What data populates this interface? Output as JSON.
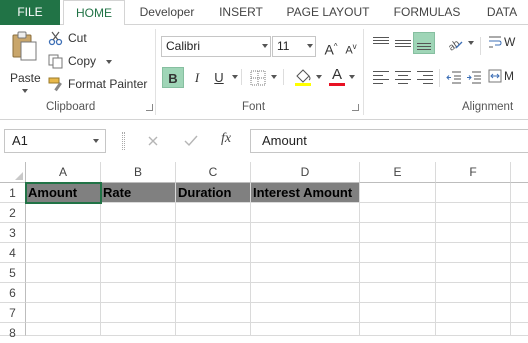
{
  "tabs": [
    "FILE",
    "HOME",
    "Developer",
    "INSERT",
    "PAGE LAYOUT",
    "FORMULAS",
    "DATA"
  ],
  "clipboard": {
    "paste": "Paste",
    "cut": "Cut",
    "copy": "Copy",
    "format_painter": "Format Painter",
    "label": "Clipboard"
  },
  "font": {
    "name": "Calibri",
    "size": "11",
    "label": "Font",
    "bold": "B",
    "italic": "I",
    "underline": "U",
    "grow": "A",
    "shrink": "A",
    "font_color": "A",
    "font_color_hex": "#e81123",
    "highlight_hex": "#ffff00"
  },
  "alignment": {
    "label": "Alignment",
    "wrap_abbrev": "W",
    "merge_abbrev": "M"
  },
  "formula_bar": {
    "name_box": "A1",
    "fx": "fx",
    "value": "Amount"
  },
  "columns": [
    "A",
    "B",
    "C",
    "D",
    "E",
    "F"
  ],
  "rows": [
    "1",
    "2",
    "3",
    "4",
    "5",
    "6",
    "7",
    "8"
  ],
  "row1": [
    "Amount",
    "Rate",
    "Duration",
    "Interest Amount"
  ],
  "colors": {
    "accent": "#217346",
    "header_fill": "#808080",
    "bold_active": "#9fd5b7"
  }
}
